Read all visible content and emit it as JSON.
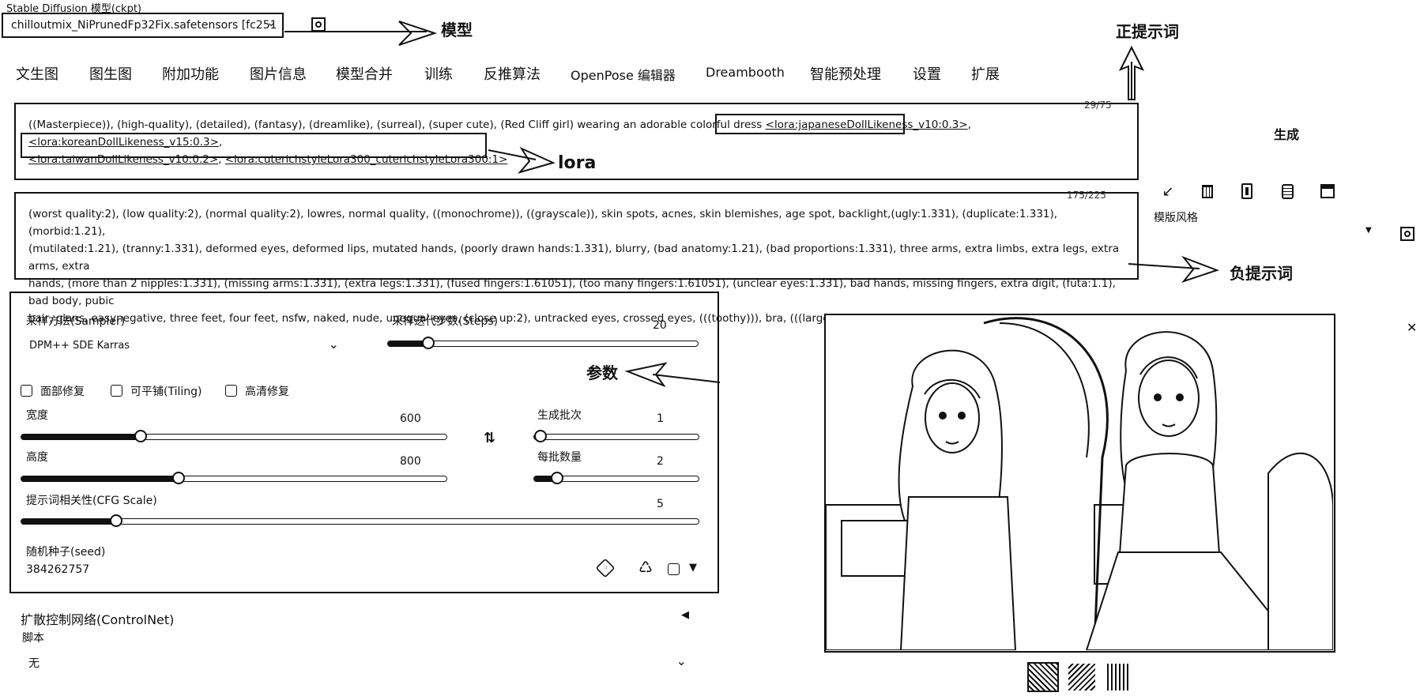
{
  "model": {
    "label": "Stable Diffusion 模型(ckpt)",
    "selected": "chilloutmix_NiPrunedFp32Fix.safetensors [fc251"
  },
  "tabs": [
    "文生图",
    "图生图",
    "附加功能",
    "图片信息",
    "模型合并",
    "训练",
    "反推算法",
    "OpenPose 编辑器",
    "Dreambooth",
    "智能预处理",
    "设置",
    "扩展"
  ],
  "positive_prompt": {
    "counter": "29/75",
    "line1_plain": "((Masterpiece)), (high-quality), (detailed), (fantasy), (dreamlike), (surreal), (super cute), (Red Cliff girl) wearing an adorable colorful dress ",
    "lora1": "<lora:japaneseDollLikeness_v10:0.3>",
    "sep1": ", ",
    "lora2": "<lora:koreanDollLikeness_v15:0.3>",
    "sep2": ",",
    "lora3": "<lora:taiwanDollLikeness_v10:0.2>",
    "sep3": ", ",
    "lora4": "<lora:cuterichstyleLora300_cuterichstyleLora300:1>"
  },
  "negative_prompt": {
    "counter": "175/225",
    "line1": "(worst quality:2), (low quality:2), (normal quality:2), lowres, normal quality, ((monochrome)), ((grayscale)), skin spots, acnes, skin blemishes, age spot, backlight,(ugly:1.331), (duplicate:1.331), (morbid:1.21),",
    "line2": "(mutilated:1.21), (tranny:1.331), deformed eyes, deformed lips, mutated hands, (poorly drawn hands:1.331), blurry, (bad anatomy:1.21), (bad proportions:1.331), three arms, extra limbs, extra legs, extra arms, extra",
    "line3": "hands, (more than 2 nipples:1.331), (missing arms:1.331), (extra legs:1.331), (fused fingers:1.61051), (too many fingers:1.61051), (unclear eyes:1.331), bad hands, missing fingers, extra digit, (futa:1.1), bad body, pubic",
    "line4": "hair, glans, easynegative, three feet, four feet, nsfw, naked, nude, unequal eyes, (close up:2), untracked eyes, crossed eyes, (((toothy))), bra, (((large breast)))"
  },
  "right_panel": {
    "generate": "生成",
    "style_label": "模版风格"
  },
  "params": {
    "sampler_label": "采样方法(Sampler)",
    "sampler_value": "DPM++ SDE Karras",
    "steps_label": "采样迭代步数(Steps)",
    "steps_value": "20",
    "steps_frac": 0.13,
    "face_restore": "面部修复",
    "tiling": "可平铺(Tiling)",
    "hires": "高清修复",
    "width_label": "宽度",
    "width_value": "600",
    "width_frac": 0.28,
    "height_label": "高度",
    "height_value": "800",
    "height_frac": 0.37,
    "batch_count_label": "生成批次",
    "batch_count_value": "1",
    "batch_count_frac": 0.0,
    "batch_size_label": "每批数量",
    "batch_size_value": "2",
    "batch_size_frac": 0.14,
    "cfg_label": "提示词相关性(CFG Scale)",
    "cfg_value": "5",
    "cfg_frac": 0.14,
    "seed_label": "随机种子(seed)",
    "seed_value": "384262757",
    "controlnet": "扩散控制网络(ControlNet)",
    "script_label": "脚本",
    "script_value": "无"
  },
  "annotations": {
    "model": "模型",
    "positive": "正提示词",
    "lora": "lora",
    "negative": "负提示词",
    "params": "参数"
  },
  "icons": [
    "refresh-icon",
    "arrow-icon",
    "trash-icon",
    "card-icon",
    "clipboard-icon",
    "save-icon",
    "swap-icon",
    "dice-icon",
    "recycle-icon",
    "close-icon",
    "chevron-down-icon"
  ]
}
